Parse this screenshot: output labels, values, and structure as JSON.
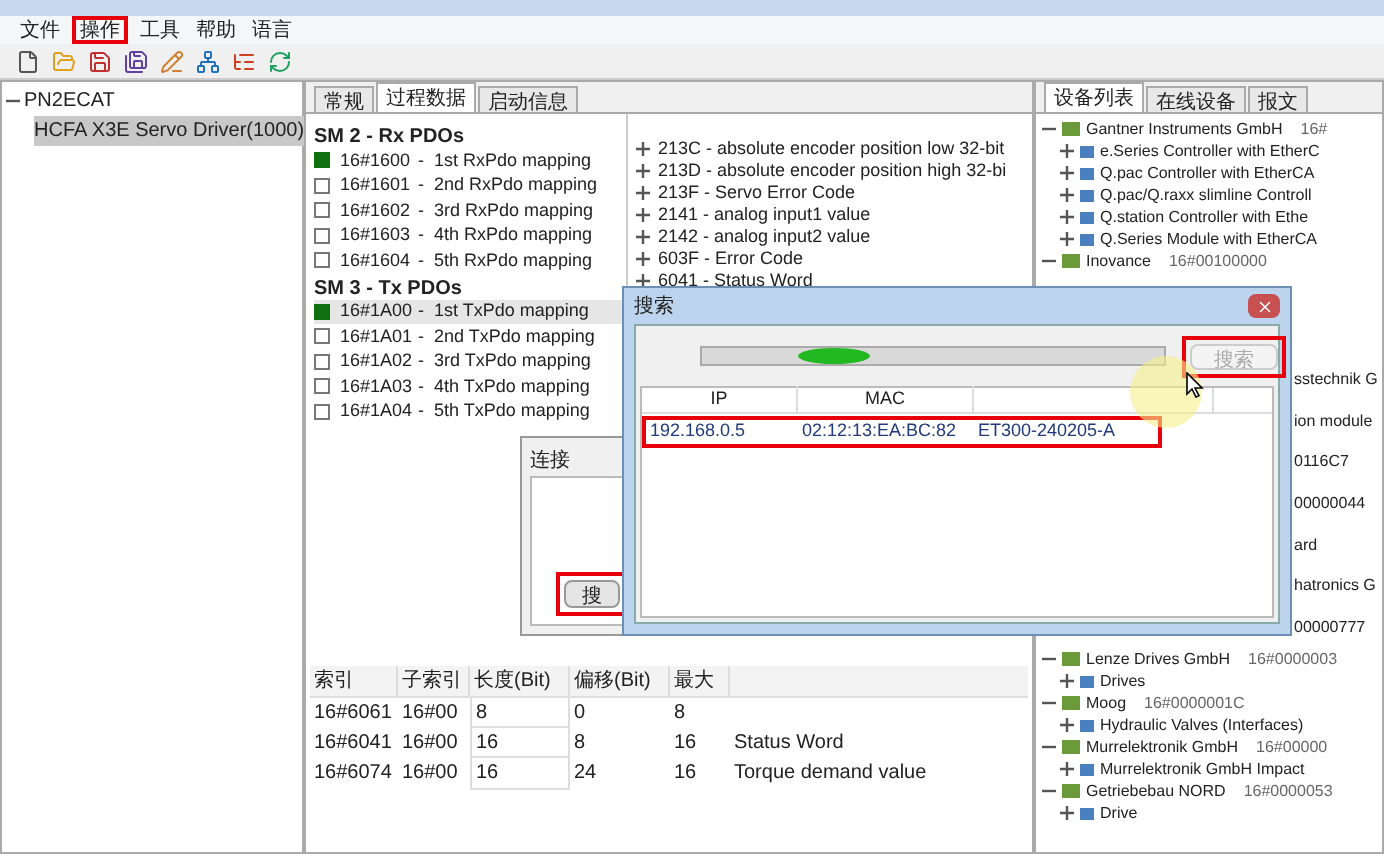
{
  "menu": [
    {
      "label": "文件",
      "highlighted": false
    },
    {
      "label": "操作",
      "highlighted": true
    },
    {
      "label": "工具",
      "highlighted": false
    },
    {
      "label": "帮助",
      "highlighted": false
    },
    {
      "label": "语言",
      "highlighted": false
    }
  ],
  "project_tree": [
    {
      "label": "PN2ECAT",
      "selected": false,
      "expanded": true,
      "children": [
        {
          "label": "HCFA X3E Servo Driver(1000)",
          "selected": true
        }
      ]
    }
  ],
  "tabs": [
    {
      "label": "常规",
      "selected": false
    },
    {
      "label": "过程数据",
      "selected": true
    },
    {
      "label": "启动信息",
      "selected": false
    }
  ],
  "pdo_groups": [
    {
      "title": "SM 2 - Rx PDOs",
      "items": [
        {
          "index": "16#1600",
          "separator": "-",
          "name": "1st RxPdo mapping",
          "checked": true,
          "selected": false
        },
        {
          "index": "16#1601",
          "separator": "-",
          "name": "2nd RxPdo mapping",
          "checked": false,
          "selected": false
        },
        {
          "index": "16#1602",
          "separator": "-",
          "name": "3rd RxPdo mapping",
          "checked": false,
          "selected": false
        },
        {
          "index": "16#1603",
          "separator": "-",
          "name": "4th RxPdo mapping",
          "checked": false,
          "selected": false
        },
        {
          "index": "16#1604",
          "separator": "-",
          "name": "5th RxPdo mapping",
          "checked": false,
          "selected": false
        }
      ]
    },
    {
      "title": "SM 3 - Tx PDOs",
      "items": [
        {
          "index": "16#1A00",
          "separator": "-",
          "name": "1st TxPdo mapping",
          "checked": true,
          "selected": true
        },
        {
          "index": "16#1A01",
          "separator": "-",
          "name": "2nd TxPdo mapping",
          "checked": false,
          "selected": false
        },
        {
          "index": "16#1A02",
          "separator": "-",
          "name": "3rd TxPdo mapping",
          "checked": false,
          "selected": false
        },
        {
          "index": "16#1A03",
          "separator": "-",
          "name": "4th TxPdo mapping",
          "checked": false,
          "selected": false
        },
        {
          "index": "16#1A04",
          "separator": "-",
          "name": "5th TxPdo mapping",
          "checked": false,
          "selected": false
        }
      ]
    }
  ],
  "object_entries": [
    {
      "label": "213C - absolute encoder position low 32-bit",
      "expanded": false
    },
    {
      "label": "213D - absolute encoder position high 32-bi",
      "expanded": false
    },
    {
      "label": "213F - Servo Error Code",
      "expanded": false
    },
    {
      "label": "2141 - analog input1 value",
      "expanded": false
    },
    {
      "label": "2142 - analog input2 value",
      "expanded": false
    },
    {
      "label": "603F - Error Code",
      "expanded": false
    },
    {
      "label": "6041 - Status Word",
      "expanded": false
    }
  ],
  "mapping_table": {
    "columns": [
      "索引",
      "子索引",
      "长度(Bit)",
      "偏移(Bit)",
      "最大"
    ],
    "rows": [
      {
        "cells": [
          "16#6061",
          "16#00",
          "8",
          "0",
          "8"
        ]
      },
      {
        "cells": [
          "16#6041",
          "16#00",
          "16",
          "8",
          "16",
          "Status Word"
        ]
      },
      {
        "cells": [
          "16#6074",
          "16#00",
          "16",
          "24",
          "16",
          "Torque demand value"
        ]
      }
    ]
  },
  "device_tabs": [
    {
      "label": "设备列表",
      "selected": true
    },
    {
      "label": "在线设备",
      "selected": false
    },
    {
      "label": "报文",
      "selected": false
    }
  ],
  "device_tree_upper": [
    {
      "label": "Gantner Instruments GmbH",
      "code": "16#",
      "expanded": true,
      "children": [
        {
          "label": "e.Series Controller with EtherC",
          "expanded": false
        },
        {
          "label": "Q.pac Controller with EtherCA",
          "expanded": false
        },
        {
          "label": "Q.pac/Q.raxx slimline Controll",
          "expanded": false
        },
        {
          "label": "Q.station Controller with Ethe",
          "expanded": false
        },
        {
          "label": "Q.Series Module with EtherCA",
          "expanded": false
        }
      ]
    },
    {
      "label": "Inovance",
      "code": "16#00100000",
      "expanded": true
    }
  ],
  "device_tree_covered": [
    "sstechnik G",
    "ion module",
    "0116C7",
    "00000044",
    "ard",
    "hatronics G",
    "00000777"
  ],
  "device_tree_lower": [
    {
      "label": "Lenze Drives GmbH",
      "code": "16#0000003",
      "expanded": true,
      "children": [
        {
          "label": "Drives",
          "expanded": false
        }
      ]
    },
    {
      "label": "Moog",
      "code": "16#0000001C",
      "expanded": true,
      "children": [
        {
          "label": "Hydraulic Valves (Interfaces)",
          "expanded": false
        }
      ]
    },
    {
      "label": "Murrelektronik GmbH",
      "code": "16#00000",
      "expanded": true,
      "children": [
        {
          "label": "Murrelektronik GmbH Impact",
          "expanded": false
        }
      ]
    },
    {
      "label": "Getriebebau NORD",
      "code": "16#0000053",
      "expanded": true,
      "children": [
        {
          "label": "Drive",
          "expanded": false
        }
      ]
    }
  ],
  "connect_dialog": {
    "title": "连接",
    "button": {
      "label": "搜",
      "highlighted": true
    }
  },
  "search_dialog": {
    "title": "搜索",
    "progress": {
      "level": 0.25
    },
    "search_button": {
      "label": "搜索",
      "disabled": true,
      "highlighted": true
    },
    "columns": [
      "IP",
      "MAC"
    ],
    "rows": [
      {
        "cells": [
          "192.168.0.5",
          "02:12:13:EA:BC:82",
          "ET300-240205-A"
        ],
        "highlighted": true
      }
    ]
  }
}
